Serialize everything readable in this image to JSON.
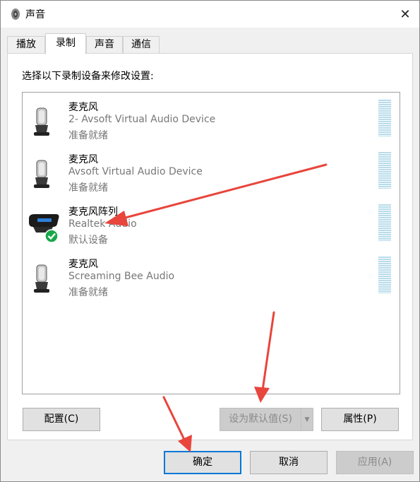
{
  "window": {
    "title": "声音",
    "close_glyph": "✕"
  },
  "tabs": [
    {
      "label": "播放"
    },
    {
      "label": "录制"
    },
    {
      "label": "声音"
    },
    {
      "label": "通信"
    }
  ],
  "instruction": "选择以下录制设备来修改设置:",
  "devices": [
    {
      "name": "麦克风",
      "desc": "2- Avsoft Virtual Audio Device",
      "status": "准备就绪",
      "icon": "microphone-icon"
    },
    {
      "name": "麦克风",
      "desc": "Avsoft Virtual Audio Device",
      "status": "准备就绪",
      "icon": "microphone-icon"
    },
    {
      "name": "麦克风阵列",
      "desc": "Realtek Audio",
      "status": "默认设备",
      "icon": "microphone-array-icon",
      "default": true
    },
    {
      "name": "麦克风",
      "desc": "Screaming Bee Audio",
      "status": "准备就绪",
      "icon": "microphone-icon"
    }
  ],
  "buttons": {
    "configure": "配置(C)",
    "set_default": "设为默认值(S)",
    "properties": "属性(P)",
    "ok": "确定",
    "cancel": "取消",
    "apply": "应用(A)"
  },
  "colors": {
    "accent": "#0078d7",
    "arrow": "#e8453c",
    "meter": "#b8dcea",
    "check": "#18a84a"
  }
}
